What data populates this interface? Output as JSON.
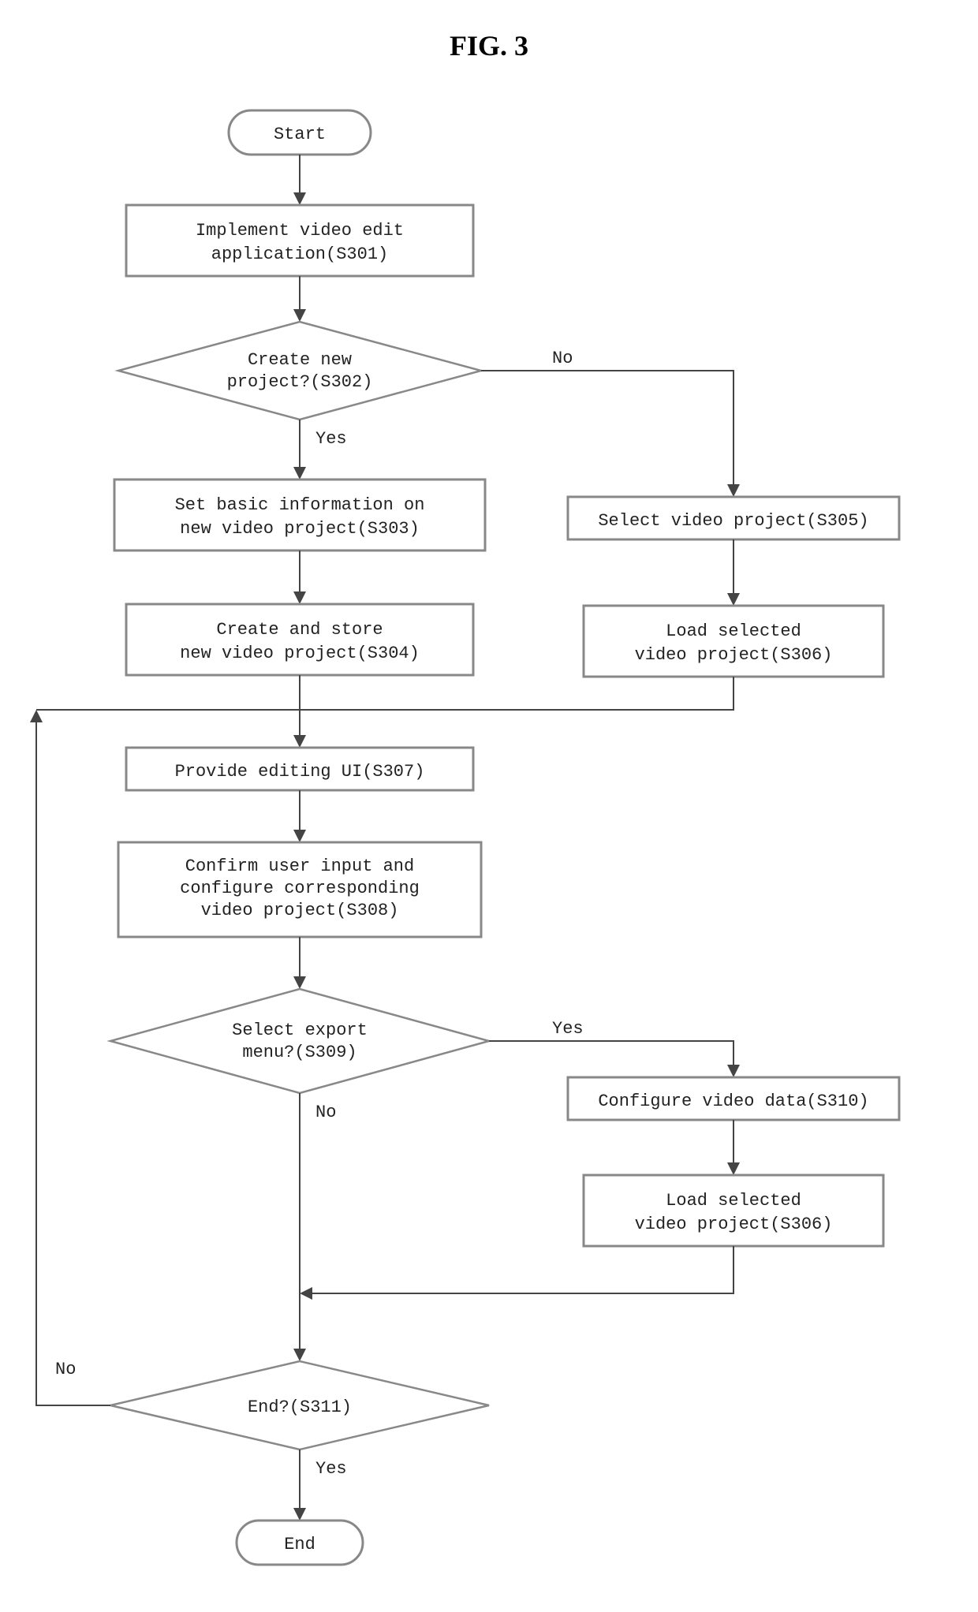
{
  "title": "FIG. 3",
  "terminators": {
    "start": "Start",
    "end": "End"
  },
  "process": {
    "s301_l1": "Implement video edit",
    "s301_l2": "application(S301)",
    "s303_l1": "Set basic information on",
    "s303_l2": "new video project(S303)",
    "s304_l1": "Create and store",
    "s304_l2": "new video project(S304)",
    "s305": "Select video project(S305)",
    "s306_l1": "Load selected",
    "s306_l2": "video project(S306)",
    "s307": "Provide editing UI(S307)",
    "s308_l1": "Confirm user input and",
    "s308_l2": "configure corresponding",
    "s308_l3": "video project(S308)",
    "s310": "Configure video data(S310)",
    "s310b_l1": "Load selected",
    "s310b_l2": "video project(S306)"
  },
  "decisions": {
    "s302_l1": "Create new",
    "s302_l2": "project?(S302)",
    "s309_l1": "Select export",
    "s309_l2": "menu?(S309)",
    "s311": "End?(S311)"
  },
  "labels": {
    "yes": "Yes",
    "no": "No"
  }
}
